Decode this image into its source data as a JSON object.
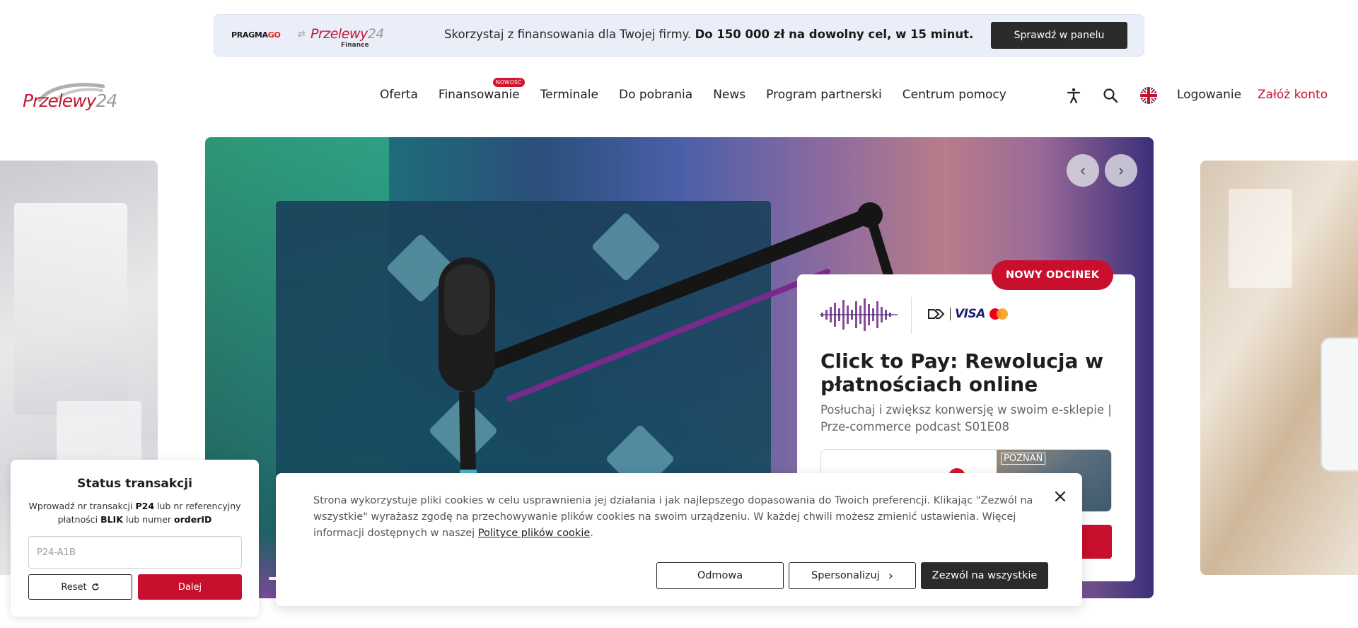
{
  "banner": {
    "partner_logo": "PRAGMAGO",
    "partner_logo_accent": "GO",
    "p24_logo": "Przelewy24",
    "finance_label": "Finance",
    "text_plain": "Skorzystaj z finansowania dla Twojej firmy. ",
    "text_bold": "Do 150 000 zł na dowolny cel, w 15 minut.",
    "button_label": "Sprawdź w panelu"
  },
  "header": {
    "logo_main": "Przelewy",
    "logo_num": "24",
    "nav": [
      {
        "label": "Oferta"
      },
      {
        "label": "Finansowanie",
        "badge": "NOWOŚĆ"
      },
      {
        "label": "Terminale"
      },
      {
        "label": "Do pobrania"
      },
      {
        "label": "News"
      },
      {
        "label": "Program partnerski"
      },
      {
        "label": "Centrum pomocy"
      }
    ],
    "icons": [
      "accessibility-icon",
      "search-icon",
      "uk-flag-icon"
    ],
    "login": "Logowanie",
    "register": "Załóż konto"
  },
  "hero": {
    "prev_icon": "chevron-left-icon",
    "next_icon": "chevron-right-icon",
    "card": {
      "badge": "NOWY ODCINEK",
      "visa": "VISA",
      "title": "Click to Pay: Rewolucja w płatnościach online",
      "subtitle": "Posłuchaj i zwiększ konwersję w swoim e-sklepie | Prze-commerce podcast S01E08",
      "thumb_label": "POZNAŃ"
    }
  },
  "transaction": {
    "title": "Status transakcji",
    "desc_1": "Wprowadź nr transakcji ",
    "desc_b1": "P24",
    "desc_2": " lub nr referencyjny płatności ",
    "desc_b2": "BLIK",
    "desc_3": " lub numer ",
    "desc_b3": "orderID",
    "input_placeholder": "P24-A1B",
    "reset_label": "Reset",
    "next_label": "Dalej"
  },
  "cookie": {
    "text": "Strona wykorzystuje pliki cookies w celu usprawnienia jej działania i jak najlepszego dopasowania do Twoich preferencji. Klikając \"Zezwól na wszystkie\" wyrażasz zgodę na przechowywanie plików cookies na swoim urządzeniu. W każdej chwili możesz zmienić ustawienia. Więcej informacji dostępnych w naszej ",
    "link": "Polityce plików cookie",
    "tail": ".",
    "deny": "Odmowa",
    "personalize": "Spersonalizuj",
    "allow_all": "Zezwól na wszystkie"
  },
  "colors": {
    "brand_red": "#c8102e",
    "dark_button": "#2b2b2b",
    "banner_bg": "#e9eef8"
  }
}
